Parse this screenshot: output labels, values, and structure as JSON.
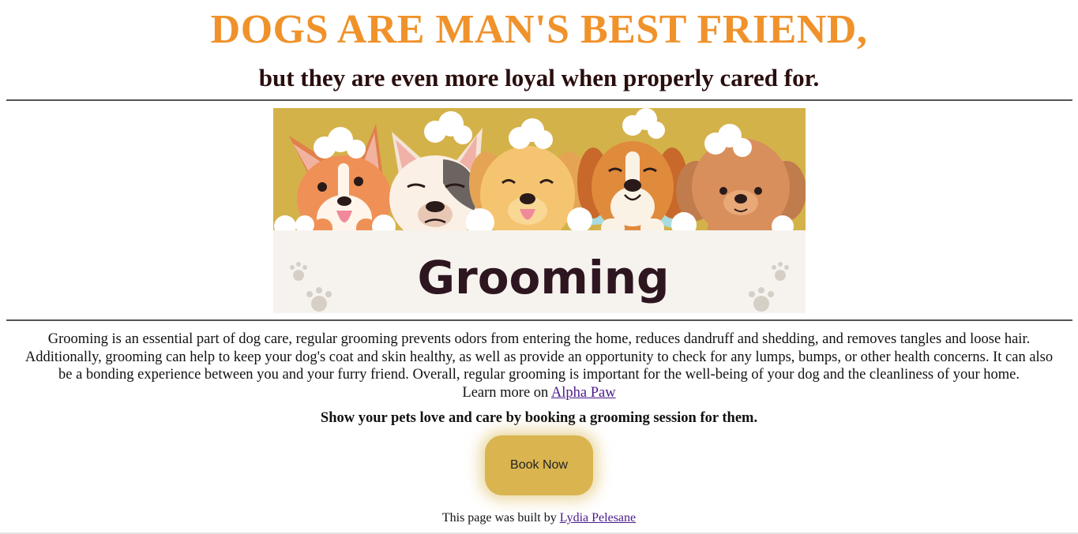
{
  "header": {
    "title": "DOGS ARE MAN'S BEST FRIEND,",
    "subtitle": "but they are even more loyal when properly cared for."
  },
  "banner": {
    "caption": "Grooming",
    "background_color": "#d4b24a"
  },
  "content": {
    "paragraph": "Grooming is an essential part of dog care, regular grooming prevents odors from entering the home, reduces dandruff and shedding, and removes tangles and loose hair. Additionally, grooming can help to keep your dog's coat and skin healthy, as well as provide an opportunity to check for any lumps, bumps, or other health concerns. It can also be a bonding experience between you and your furry friend. Overall, regular grooming is important for the well-being of your dog and the cleanliness of your home.",
    "learn_more_prefix": "Learn more on ",
    "learn_more_link": "Alpha Paw",
    "cta_text": "Show your pets love and care by booking a grooming session for them."
  },
  "actions": {
    "book_label": "Book Now",
    "button_color": "#d9b44f"
  },
  "footer": {
    "prefix": "This page was built by ",
    "author_link": "Lydia Pelesane"
  },
  "colors": {
    "title": "#f0922b",
    "subtitle": "#2a0e0e",
    "link": "#4b1a8b"
  }
}
